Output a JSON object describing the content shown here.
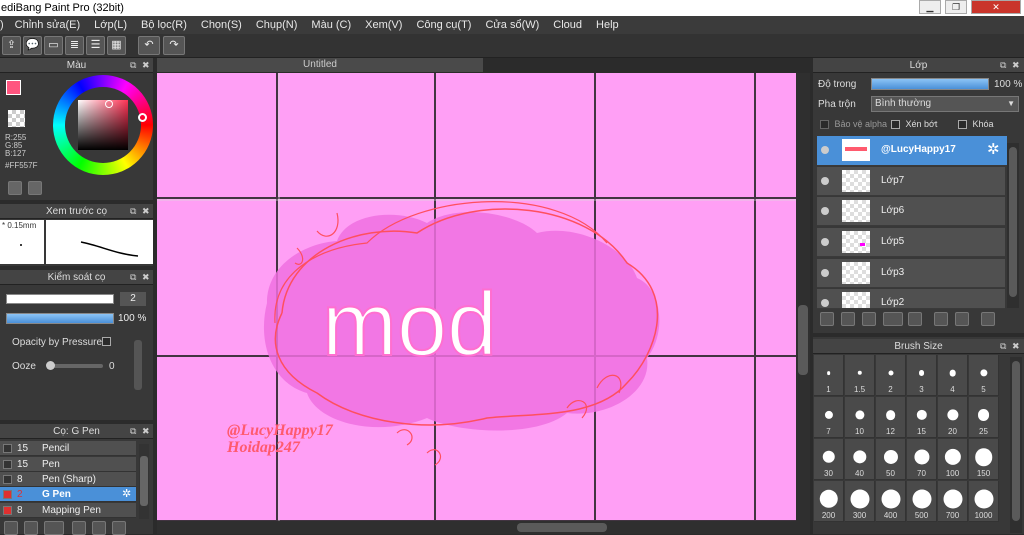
{
  "window": {
    "title": "ediBang Paint Pro (32bit)"
  },
  "menu": [
    "Chỉnh sửa(E)",
    "Lớp(L)",
    "Bộ lọc(R)",
    "Chọn(S)",
    "Chụp(N)",
    "Màu (C)",
    "Xem(V)",
    "Công cụ(T)",
    "Cửa sổ(W)",
    "Cloud",
    "Help"
  ],
  "menu_first": ")",
  "color_panel": {
    "title": "Màu",
    "r": "R:255",
    "g": "G:85",
    "b": "B:127",
    "hex": "#FF557F",
    "main_color": "#ff557f"
  },
  "brush_preview": {
    "title": "Xem trước cọ",
    "size": "* 0.15mm"
  },
  "brush_control": {
    "title": "Kiểm soát cọ",
    "size_value": "2",
    "opacity_value": "100 %",
    "opacity_fraction": 1.0,
    "pressure_label": "Opacity by Pressure",
    "ooze_label": "Ooze",
    "ooze_value": "0"
  },
  "brush_list": {
    "title": "Cọ: G Pen",
    "items": [
      {
        "num": "15",
        "name": "Pencil",
        "swatch": "#2f2f2f",
        "selected": false
      },
      {
        "num": "15",
        "name": "Pen",
        "swatch": "#2f2f2f",
        "selected": false
      },
      {
        "num": "8",
        "name": "Pen (Sharp)",
        "swatch": "#2f2f2f",
        "selected": false
      },
      {
        "num": "2",
        "name": "G Pen",
        "swatch": "#e03030",
        "selected": true
      },
      {
        "num": "8",
        "name": "Mapping Pen",
        "swatch": "#e03030",
        "selected": false
      }
    ]
  },
  "document": {
    "tab": "Untitled",
    "canvas_color": "#ff9ff5",
    "text_mod": "mod",
    "watermark1": "@LucyHappy17",
    "watermark2": "Hoidap247"
  },
  "layer_panel": {
    "title": "Lớp",
    "opacity_label": "Độ trong",
    "opacity_value": "100 %",
    "opacity_fraction": 1.0,
    "blend_label": "Pha trộn",
    "blend_value": "Bình thường",
    "protect_alpha": "Bảo vệ alpha",
    "clipping": "Xén bớt",
    "lock": "Khóa",
    "layers": [
      {
        "name": "@LucyHappy17",
        "selected": true
      },
      {
        "name": "Lớp7",
        "selected": false
      },
      {
        "name": "Lớp6",
        "selected": false
      },
      {
        "name": "Lớp5",
        "selected": false
      },
      {
        "name": "Lớp3",
        "selected": false
      },
      {
        "name": "Lớp2",
        "selected": false
      }
    ]
  },
  "brush_size": {
    "title": "Brush Size",
    "sizes": [
      "1",
      "1.5",
      "2",
      "3",
      "4",
      "5",
      "7",
      "10",
      "12",
      "15",
      "20",
      "25",
      "30",
      "40",
      "50",
      "70",
      "100",
      "150",
      "200",
      "300",
      "400",
      "500",
      "700",
      "1000"
    ]
  }
}
